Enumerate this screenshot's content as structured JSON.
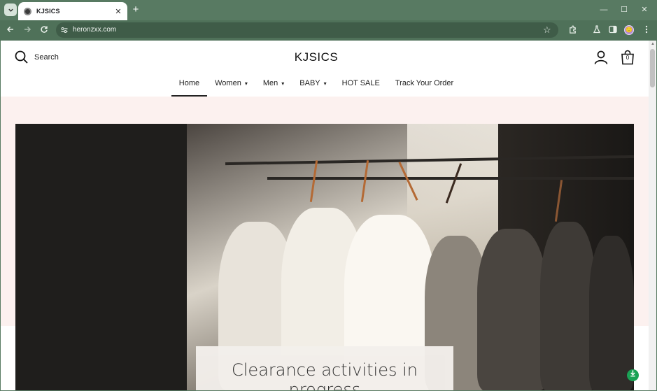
{
  "browser": {
    "tab_title": "KJSICS",
    "url": "heronzxx.com",
    "new_tab_symbol": "+",
    "minimize_symbol": "—",
    "maximize_symbol": "☐",
    "close_symbol": "✕",
    "tab_close_symbol": "✕",
    "icons": [
      "tab-search-icon",
      "back-icon",
      "forward-icon",
      "reload-icon",
      "site-info-icon",
      "bookmark-star-icon",
      "extensions-icon",
      "labs-icon",
      "side-panel-icon",
      "profile-avatar",
      "menu-kebab-icon"
    ],
    "profile_initial": "🙂"
  },
  "header": {
    "search_label": "Search",
    "logo": "KJSICS",
    "cart_count": "0"
  },
  "menu": {
    "items": [
      {
        "label": "Home",
        "active": true,
        "dropdown": false
      },
      {
        "label": "Women",
        "active": false,
        "dropdown": true
      },
      {
        "label": "Men",
        "active": false,
        "dropdown": true
      },
      {
        "label": "BABY",
        "active": false,
        "dropdown": true
      },
      {
        "label": "HOT SALE",
        "active": false,
        "dropdown": false
      },
      {
        "label": "Track Your Order",
        "active": false,
        "dropdown": false
      }
    ],
    "chevron": "▾"
  },
  "hero": {
    "caption": "Clearance activities in progress",
    "image_subject": "clothes-rack-photo"
  },
  "colors": {
    "browser_frame": "#587a62",
    "page_band": "#fcf1ef",
    "float_button": "#1aa255"
  }
}
